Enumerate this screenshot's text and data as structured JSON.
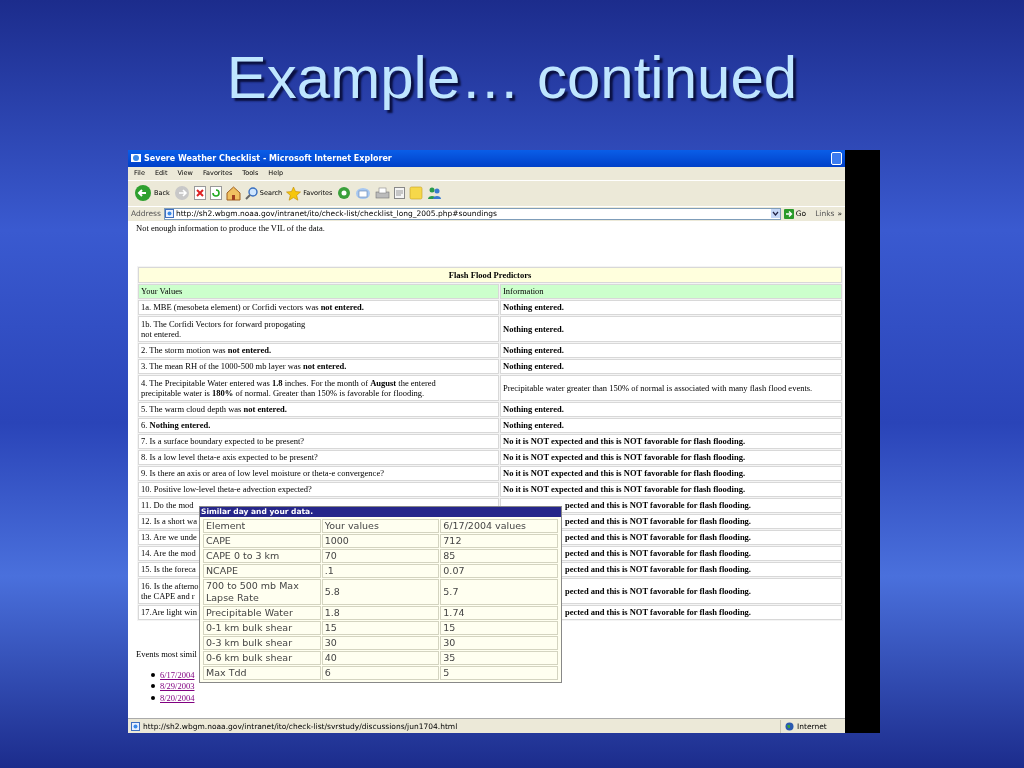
{
  "slide": {
    "title": "Example… continued"
  },
  "window": {
    "title": "Severe Weather Checklist - Microsoft Internet Explorer",
    "menu": [
      "File",
      "Edit",
      "View",
      "Favorites",
      "Tools",
      "Help"
    ],
    "toolbar": [
      {
        "kind": "back",
        "label": "Back"
      },
      {
        "kind": "forward"
      },
      {
        "kind": "stop"
      },
      {
        "kind": "refresh"
      },
      {
        "kind": "home"
      },
      {
        "kind": "search",
        "label": "Search"
      },
      {
        "kind": "favorites",
        "label": "Favorites"
      },
      {
        "kind": "media"
      },
      {
        "kind": "mail"
      },
      {
        "kind": "print"
      },
      {
        "kind": "edit"
      },
      {
        "kind": "folder"
      },
      {
        "kind": "messenger"
      }
    ],
    "address": {
      "label": "Address",
      "value": "http://sh2.wbgm.noaa.gov/intranet/ito/check-list/checklist_long_2005.php#soundings",
      "go": "Go",
      "links": "Links",
      "more": "»"
    },
    "status_bar": {
      "text": "http://sh2.wbgm.noaa.gov/intranet/ito/check-list/svrstudy/discussions/jun1704.html",
      "zone": "Internet"
    }
  },
  "page": {
    "note": "Not enough information to produce the VIL of the data.",
    "table": {
      "title": "Flash Flood Predictors",
      "columns": [
        "Your Values",
        "Information"
      ],
      "rows": [
        {
          "value": "1a. MBE (mesobeta element) or Corfidi vectors was **not entered.**",
          "info": "Nothing entered.",
          "info_bold": true,
          "covered": false
        },
        {
          "value": "1b. The Corfidi Vectors for forward propogating\nnot entered.",
          "info": "Nothing entered.",
          "info_bold": true,
          "covered": false
        },
        {
          "value": "2. The storm motion was **not entered.**",
          "info": "Nothing entered.",
          "info_bold": true,
          "covered": false
        },
        {
          "value": "3. The mean RH of the 1000-500 mb layer was **not entered.**",
          "info": "Nothing entered.",
          "info_bold": true,
          "covered": false
        },
        {
          "value": "4. The Precipitable Water entered was **1.8** inches. For the month of **August** the entered\nprecipitable water is **180%** of normal. Greater than 150% is favorable for flooding.",
          "info": "Precipitable water greater than 150% of normal is associated with many flash flood events.",
          "info_bold": false,
          "covered": false
        },
        {
          "value": "5. The warm cloud depth was **not entered.**",
          "info": "Nothing entered.",
          "info_bold": true,
          "covered": false
        },
        {
          "value": "6. **Nothing entered.**",
          "info": "Nothing entered.",
          "info_bold": true,
          "covered": false
        },
        {
          "value": "7. Is a surface boundary expected to be present?",
          "info": "No it is NOT expected and this is NOT favorable for flash flooding.",
          "info_bold": true,
          "covered": false
        },
        {
          "value": "8. Is a low level theta-e axis expected to be present?",
          "info": "No it is NOT expected and this is NOT favorable for flash flooding.",
          "info_bold": true,
          "covered": false
        },
        {
          "value": "9. Is there an axis or area of low level moisture or theta-e convergence?",
          "info": "No it is NOT expected and this is NOT favorable for flash flooding.",
          "info_bold": true,
          "covered": false
        },
        {
          "value": "10. Positive low-level theta-e advection expected?",
          "info": "No it is NOT expected and this is NOT favorable for flash flooding.",
          "info_bold": true,
          "covered": false
        },
        {
          "value": "11. Do the mod",
          "info": "pected and this is NOT favorable for flash flooding.",
          "info_bold": true,
          "covered": true
        },
        {
          "value": "12. Is a short wa",
          "info": "pected and this is NOT favorable for flash flooding.",
          "info_bold": true,
          "covered": true
        },
        {
          "value": "13. Are we unde",
          "info": "pected and this is NOT favorable for flash flooding.",
          "info_bold": true,
          "covered": true
        },
        {
          "value": "14. Are the mod",
          "info": "pected and this is NOT favorable for flash flooding.",
          "info_bold": true,
          "covered": true
        },
        {
          "value": "15. Is the foreca",
          "info": "pected and this is NOT favorable for flash flooding.",
          "info_bold": true,
          "covered": true
        },
        {
          "value": "16. Is the afterno\nthe CAPE and r",
          "info": "pected and this is NOT favorable for flash flooding.",
          "info_bold": true,
          "covered": true
        },
        {
          "value": "17.Are light win",
          "info": "pected and this is NOT favorable for flash flooding.",
          "info_bold": true,
          "covered": true
        }
      ]
    },
    "events_label": "Events most simil",
    "events": [
      {
        "label": "6/17/2004"
      },
      {
        "label": "8/29/2003"
      },
      {
        "label": "8/20/2004"
      }
    ],
    "popup": {
      "title": "Similar day and your data.",
      "columns": [
        "Element",
        "Your values",
        "6/17/2004 values"
      ],
      "rows": [
        [
          "CAPE",
          "1000",
          "712"
        ],
        [
          "CAPE 0 to 3 km",
          "70",
          "85"
        ],
        [
          "NCAPE",
          ".1",
          "0.07"
        ],
        [
          "700 to 500 mb Max Lapse Rate",
          "5.8",
          "5.7"
        ],
        [
          "Precipitable Water",
          "1.8",
          "1.74"
        ],
        [
          "0-1 km bulk shear",
          "15",
          "15"
        ],
        [
          "0-3 km bulk shear",
          "30",
          "30"
        ],
        [
          "0-6 km bulk shear",
          "40",
          "35"
        ],
        [
          "Max Tdd",
          "6",
          "5"
        ]
      ]
    }
  }
}
